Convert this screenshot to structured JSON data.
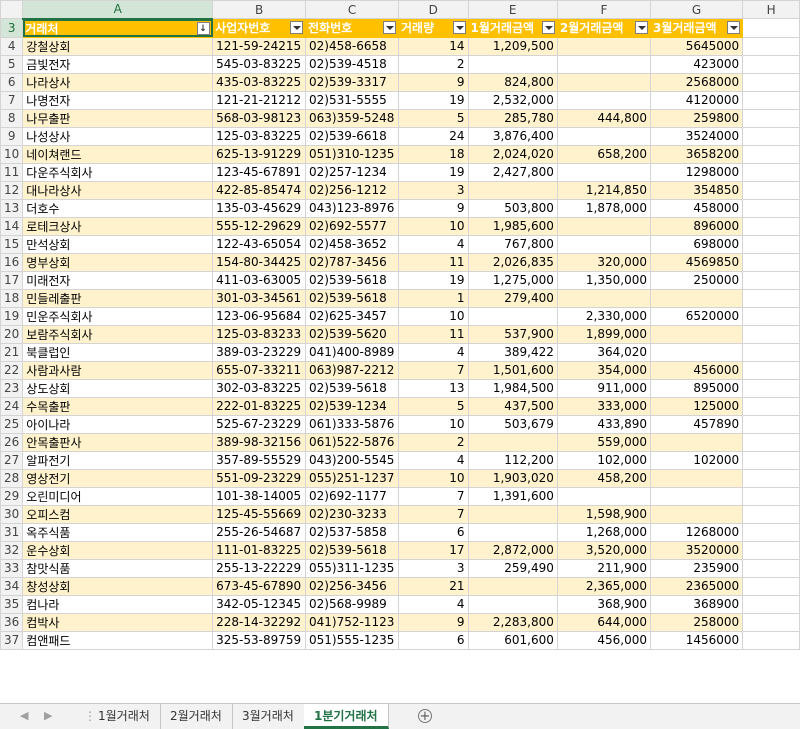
{
  "columns": [
    "A",
    "B",
    "C",
    "D",
    "E",
    "F",
    "G",
    "H"
  ],
  "header_row_number": "3",
  "headers": [
    "거래처",
    "사업자번호",
    "전화번호",
    "거래량",
    "1월거래금액",
    "2월거래금액",
    "3월거래금액"
  ],
  "rows": [
    {
      "n": "4",
      "c": [
        "강철상회",
        "121-59-24215",
        "02)458-6658",
        "14",
        "1,209,500",
        "",
        "5645000"
      ]
    },
    {
      "n": "5",
      "c": [
        "금빛전자",
        "545-03-83225",
        "02)539-4518",
        "2",
        "",
        "",
        "423000"
      ]
    },
    {
      "n": "6",
      "c": [
        "나라상사",
        "435-03-83225",
        "02)539-3317",
        "9",
        "824,800",
        "",
        "2568000"
      ]
    },
    {
      "n": "7",
      "c": [
        "나명전자",
        "121-21-21212",
        "02)531-5555",
        "19",
        "2,532,000",
        "",
        "4120000"
      ]
    },
    {
      "n": "8",
      "c": [
        "나무출판",
        "568-03-98123",
        "063)359-5248",
        "5",
        "285,780",
        "444,800",
        "259800"
      ]
    },
    {
      "n": "9",
      "c": [
        "나성상사",
        "125-03-83225",
        "02)539-6618",
        "24",
        "3,876,400",
        "",
        "3524000"
      ]
    },
    {
      "n": "10",
      "c": [
        "네이쳐랜드",
        "625-13-91229",
        "051)310-1235",
        "18",
        "2,024,020",
        "658,200",
        "3658200"
      ]
    },
    {
      "n": "11",
      "c": [
        "다운주식회사",
        "123-45-67891",
        "02)257-1234",
        "19",
        "2,427,800",
        "",
        "1298000"
      ]
    },
    {
      "n": "12",
      "c": [
        "대나라상사",
        "422-85-85474",
        "02)256-1212",
        "3",
        "",
        "1,214,850",
        "354850"
      ]
    },
    {
      "n": "13",
      "c": [
        "더호수",
        "135-03-45629",
        "043)123-8976",
        "9",
        "503,800",
        "1,878,000",
        "458000"
      ]
    },
    {
      "n": "14",
      "c": [
        "로테크상사",
        "555-12-29629",
        "02)692-5577",
        "10",
        "1,985,600",
        "",
        "896000"
      ]
    },
    {
      "n": "15",
      "c": [
        "만석상회",
        "122-43-65054",
        "02)458-3652",
        "4",
        "767,800",
        "",
        "698000"
      ]
    },
    {
      "n": "16",
      "c": [
        "명부상회",
        "154-80-34425",
        "02)787-3456",
        "11",
        "2,026,835",
        "320,000",
        "4569850"
      ]
    },
    {
      "n": "17",
      "c": [
        "미래전자",
        "411-03-63005",
        "02)539-5618",
        "19",
        "1,275,000",
        "1,350,000",
        "250000"
      ]
    },
    {
      "n": "18",
      "c": [
        "민들레출판",
        "301-03-34561",
        "02)539-5618",
        "1",
        "279,400",
        "",
        ""
      ]
    },
    {
      "n": "19",
      "c": [
        "민운주식회사",
        "123-06-95684",
        "02)625-3457",
        "10",
        "",
        "2,330,000",
        "6520000"
      ]
    },
    {
      "n": "20",
      "c": [
        "보람주식회사",
        "125-03-83233",
        "02)539-5620",
        "11",
        "537,900",
        "1,899,000",
        ""
      ]
    },
    {
      "n": "21",
      "c": [
        "북클럽인",
        "389-03-23229",
        "041)400-8989",
        "4",
        "389,422",
        "364,020",
        ""
      ]
    },
    {
      "n": "22",
      "c": [
        "사람과사람",
        "655-07-33211",
        "063)987-2212",
        "7",
        "1,501,600",
        "354,000",
        "456000"
      ]
    },
    {
      "n": "23",
      "c": [
        "상도상회",
        "302-03-83225",
        "02)539-5618",
        "13",
        "1,984,500",
        "911,000",
        "895000"
      ]
    },
    {
      "n": "24",
      "c": [
        "수목출판",
        "222-01-83225",
        "02)539-1234",
        "5",
        "437,500",
        "333,000",
        "125000"
      ]
    },
    {
      "n": "25",
      "c": [
        "아이나라",
        "525-67-23229",
        "061)333-5876",
        "10",
        "503,679",
        "433,890",
        "457890"
      ]
    },
    {
      "n": "26",
      "c": [
        "안목출판사",
        "389-98-32156",
        "061)522-5876",
        "2",
        "",
        "559,000",
        ""
      ]
    },
    {
      "n": "27",
      "c": [
        "알파전기",
        "357-89-55529",
        "043)200-5545",
        "4",
        "112,200",
        "102,000",
        "102000"
      ]
    },
    {
      "n": "28",
      "c": [
        "영상전기",
        "551-09-23229",
        "055)251-1237",
        "10",
        "1,903,020",
        "458,200",
        ""
      ]
    },
    {
      "n": "29",
      "c": [
        "오린미디어",
        "101-38-14005",
        "02)692-1177",
        "7",
        "1,391,600",
        "",
        ""
      ]
    },
    {
      "n": "30",
      "c": [
        "오피스컴",
        "125-45-55669",
        "02)230-3233",
        "7",
        "",
        "1,598,900",
        ""
      ]
    },
    {
      "n": "31",
      "c": [
        "옥주식품",
        "255-26-54687",
        "02)537-5858",
        "6",
        "",
        "1,268,000",
        "1268000"
      ]
    },
    {
      "n": "32",
      "c": [
        "운수상회",
        "111-01-83225",
        "02)539-5618",
        "17",
        "2,872,000",
        "3,520,000",
        "3520000"
      ]
    },
    {
      "n": "33",
      "c": [
        "참맛식품",
        "255-13-22229",
        "055)311-1235",
        "3",
        "259,490",
        "211,900",
        "235900"
      ]
    },
    {
      "n": "34",
      "c": [
        "창성상회",
        "673-45-67890",
        "02)256-3456",
        "21",
        "",
        "2,365,000",
        "2365000"
      ]
    },
    {
      "n": "35",
      "c": [
        "컴나라",
        "342-05-12345",
        "02)568-9989",
        "4",
        "",
        "368,900",
        "368900"
      ]
    },
    {
      "n": "36",
      "c": [
        "컴박사",
        "228-14-32292",
        "041)752-1123",
        "9",
        "2,283,800",
        "644,000",
        "258000"
      ]
    },
    {
      "n": "37",
      "c": [
        "컴앤패드",
        "325-53-89759",
        "051)555-1235",
        "6",
        "601,600",
        "456,000",
        "1456000"
      ]
    }
  ],
  "tabs": [
    "1월거래처",
    "2월거래처",
    "3월거래처",
    "1분기거래처"
  ],
  "active_tab": "1분기거래처",
  "colors": {
    "header_fill": "#ffc000",
    "band_fill": "#fff2cc",
    "accent": "#217346"
  }
}
